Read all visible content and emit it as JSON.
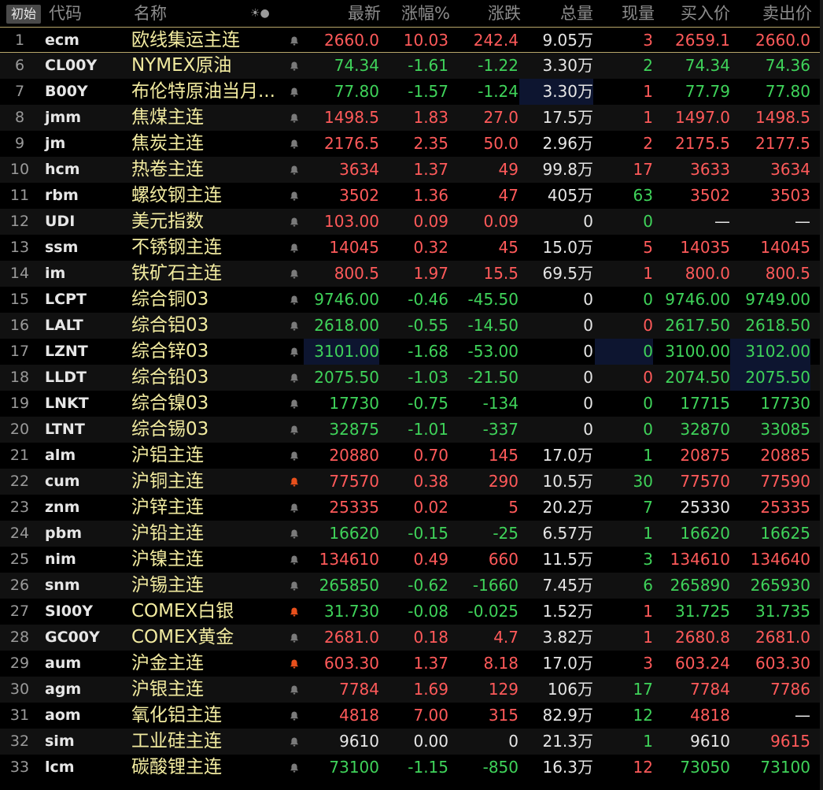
{
  "header": {
    "init_label": "初始",
    "columns": [
      "代码",
      "名称",
      "",
      "最新",
      "涨幅%",
      "涨跌",
      "总量",
      "现量",
      "买入价",
      "卖出价"
    ],
    "sort_icon": "☀●"
  },
  "rows": [
    {
      "idx": "1",
      "code": "ecm",
      "name": "欧线集运主连",
      "alert": false,
      "last": "2660.0",
      "pct": "10.03",
      "chg": "242.4",
      "vol": "9.05万",
      "cur": "3",
      "bid": "2659.1",
      "ask": "2660.0",
      "dir": "up",
      "bidDir": "up",
      "askDir": "up",
      "curDir": "up"
    },
    {
      "idx": "6",
      "code": "CL00Y",
      "name": "NYMEX原油",
      "alert": false,
      "last": "74.34",
      "pct": "-1.61",
      "chg": "-1.22",
      "vol": "3.30万",
      "cur": "2",
      "bid": "74.34",
      "ask": "74.36",
      "dir": "down",
      "bidDir": "down",
      "askDir": "down",
      "curDir": "down"
    },
    {
      "idx": "7",
      "code": "B00Y",
      "name": "布伦特原油当月...",
      "alert": false,
      "last": "77.80",
      "pct": "-1.57",
      "chg": "-1.24",
      "vol": "3.30万",
      "cur": "1",
      "bid": "77.79",
      "ask": "77.80",
      "dir": "down",
      "bidDir": "down",
      "askDir": "down",
      "curDir": "up",
      "volHl": true
    },
    {
      "idx": "8",
      "code": "jmm",
      "name": "焦煤主连",
      "alert": false,
      "last": "1498.5",
      "pct": "1.83",
      "chg": "27.0",
      "vol": "17.5万",
      "cur": "1",
      "bid": "1497.0",
      "ask": "1498.5",
      "dir": "up",
      "bidDir": "up",
      "askDir": "up",
      "curDir": "up"
    },
    {
      "idx": "9",
      "code": "jm",
      "name": "焦炭主连",
      "alert": false,
      "last": "2176.5",
      "pct": "2.35",
      "chg": "50.0",
      "vol": "2.96万",
      "cur": "2",
      "bid": "2175.5",
      "ask": "2177.5",
      "dir": "up",
      "bidDir": "up",
      "askDir": "up",
      "curDir": "up"
    },
    {
      "idx": "10",
      "code": "hcm",
      "name": "热卷主连",
      "alert": false,
      "last": "3634",
      "pct": "1.37",
      "chg": "49",
      "vol": "99.8万",
      "cur": "17",
      "bid": "3633",
      "ask": "3634",
      "dir": "up",
      "bidDir": "up",
      "askDir": "up",
      "curDir": "up"
    },
    {
      "idx": "11",
      "code": "rbm",
      "name": "螺纹钢主连",
      "alert": false,
      "last": "3502",
      "pct": "1.36",
      "chg": "47",
      "vol": "405万",
      "cur": "63",
      "bid": "3502",
      "ask": "3503",
      "dir": "up",
      "bidDir": "up",
      "askDir": "up",
      "curDir": "down"
    },
    {
      "idx": "12",
      "code": "UDI",
      "name": "美元指数",
      "alert": false,
      "last": "103.00",
      "pct": "0.09",
      "chg": "0.09",
      "vol": "0",
      "cur": "0",
      "bid": "—",
      "ask": "—",
      "dir": "up",
      "bidDir": "flat",
      "askDir": "flat",
      "curDir": "down"
    },
    {
      "idx": "13",
      "code": "ssm",
      "name": "不锈钢主连",
      "alert": false,
      "last": "14045",
      "pct": "0.32",
      "chg": "45",
      "vol": "15.0万",
      "cur": "5",
      "bid": "14035",
      "ask": "14045",
      "dir": "up",
      "bidDir": "up",
      "askDir": "up",
      "curDir": "up"
    },
    {
      "idx": "14",
      "code": "im",
      "name": "铁矿石主连",
      "alert": false,
      "last": "800.5",
      "pct": "1.97",
      "chg": "15.5",
      "vol": "69.5万",
      "cur": "1",
      "bid": "800.0",
      "ask": "800.5",
      "dir": "up",
      "bidDir": "up",
      "askDir": "up",
      "curDir": "up"
    },
    {
      "idx": "15",
      "code": "LCPT",
      "name": "综合铜03",
      "alert": false,
      "last": "9746.00",
      "pct": "-0.46",
      "chg": "-45.50",
      "vol": "0",
      "cur": "0",
      "bid": "9746.00",
      "ask": "9749.00",
      "dir": "down",
      "bidDir": "down",
      "askDir": "down",
      "curDir": "down"
    },
    {
      "idx": "16",
      "code": "LALT",
      "name": "综合铝03",
      "alert": false,
      "last": "2618.00",
      "pct": "-0.55",
      "chg": "-14.50",
      "vol": "0",
      "cur": "0",
      "bid": "2617.50",
      "ask": "2618.50",
      "dir": "down",
      "bidDir": "down",
      "askDir": "down",
      "curDir": "up"
    },
    {
      "idx": "17",
      "code": "LZNT",
      "name": "综合锌03",
      "alert": false,
      "last": "3101.00",
      "pct": "-1.68",
      "chg": "-53.00",
      "vol": "0",
      "cur": "0",
      "bid": "3100.00",
      "ask": "3102.00",
      "dir": "down",
      "bidDir": "down",
      "askDir": "down",
      "curDir": "down",
      "lastHl": true,
      "curHl": true,
      "askHl": true
    },
    {
      "idx": "18",
      "code": "LLDT",
      "name": "综合铅03",
      "alert": false,
      "last": "2075.50",
      "pct": "-1.03",
      "chg": "-21.50",
      "vol": "0",
      "cur": "0",
      "bid": "2074.50",
      "ask": "2075.50",
      "dir": "down",
      "bidDir": "down",
      "askDir": "down",
      "curDir": "up",
      "askHl": true
    },
    {
      "idx": "19",
      "code": "LNKT",
      "name": "综合镍03",
      "alert": false,
      "last": "17730",
      "pct": "-0.75",
      "chg": "-134",
      "vol": "0",
      "cur": "0",
      "bid": "17715",
      "ask": "17730",
      "dir": "down",
      "bidDir": "down",
      "askDir": "down",
      "curDir": "down"
    },
    {
      "idx": "20",
      "code": "LTNT",
      "name": "综合锡03",
      "alert": false,
      "last": "32875",
      "pct": "-1.01",
      "chg": "-337",
      "vol": "0",
      "cur": "0",
      "bid": "32870",
      "ask": "33085",
      "dir": "down",
      "bidDir": "down",
      "askDir": "down",
      "curDir": "down"
    },
    {
      "idx": "21",
      "code": "alm",
      "name": "沪铝主连",
      "alert": false,
      "last": "20880",
      "pct": "0.70",
      "chg": "145",
      "vol": "17.0万",
      "cur": "1",
      "bid": "20875",
      "ask": "20885",
      "dir": "up",
      "bidDir": "up",
      "askDir": "up",
      "curDir": "down"
    },
    {
      "idx": "22",
      "code": "cum",
      "name": "沪铜主连",
      "alert": true,
      "last": "77570",
      "pct": "0.38",
      "chg": "290",
      "vol": "10.5万",
      "cur": "30",
      "bid": "77570",
      "ask": "77590",
      "dir": "up",
      "bidDir": "up",
      "askDir": "up",
      "curDir": "down"
    },
    {
      "idx": "23",
      "code": "znm",
      "name": "沪锌主连",
      "alert": false,
      "last": "25335",
      "pct": "0.02",
      "chg": "5",
      "vol": "20.2万",
      "cur": "7",
      "bid": "25330",
      "ask": "25335",
      "dir": "up",
      "bidDir": "flat",
      "askDir": "up",
      "curDir": "down"
    },
    {
      "idx": "24",
      "code": "pbm",
      "name": "沪铅主连",
      "alert": false,
      "last": "16620",
      "pct": "-0.15",
      "chg": "-25",
      "vol": "6.57万",
      "cur": "1",
      "bid": "16620",
      "ask": "16625",
      "dir": "down",
      "bidDir": "down",
      "askDir": "down",
      "curDir": "down"
    },
    {
      "idx": "25",
      "code": "nim",
      "name": "沪镍主连",
      "alert": false,
      "last": "134610",
      "pct": "0.49",
      "chg": "660",
      "vol": "11.5万",
      "cur": "3",
      "bid": "134610",
      "ask": "134640",
      "dir": "up",
      "bidDir": "up",
      "askDir": "up",
      "curDir": "down"
    },
    {
      "idx": "26",
      "code": "snm",
      "name": "沪锡主连",
      "alert": false,
      "last": "265850",
      "pct": "-0.62",
      "chg": "-1660",
      "vol": "7.45万",
      "cur": "6",
      "bid": "265890",
      "ask": "265930",
      "dir": "down",
      "bidDir": "down",
      "askDir": "down",
      "curDir": "down"
    },
    {
      "idx": "27",
      "code": "SI00Y",
      "name": "COMEX白银",
      "alert": true,
      "last": "31.730",
      "pct": "-0.08",
      "chg": "-0.025",
      "vol": "1.52万",
      "cur": "1",
      "bid": "31.725",
      "ask": "31.735",
      "dir": "down",
      "bidDir": "down",
      "askDir": "down",
      "curDir": "up"
    },
    {
      "idx": "28",
      "code": "GC00Y",
      "name": "COMEX黄金",
      "alert": false,
      "last": "2681.0",
      "pct": "0.18",
      "chg": "4.7",
      "vol": "3.82万",
      "cur": "1",
      "bid": "2680.8",
      "ask": "2681.0",
      "dir": "up",
      "bidDir": "up",
      "askDir": "up",
      "curDir": "up"
    },
    {
      "idx": "29",
      "code": "aum",
      "name": "沪金主连",
      "alert": true,
      "last": "603.30",
      "pct": "1.37",
      "chg": "8.18",
      "vol": "17.0万",
      "cur": "3",
      "bid": "603.24",
      "ask": "603.30",
      "dir": "up",
      "bidDir": "up",
      "askDir": "up",
      "curDir": "up"
    },
    {
      "idx": "30",
      "code": "agm",
      "name": "沪银主连",
      "alert": false,
      "last": "7784",
      "pct": "1.69",
      "chg": "129",
      "vol": "106万",
      "cur": "17",
      "bid": "7784",
      "ask": "7786",
      "dir": "up",
      "bidDir": "up",
      "askDir": "up",
      "curDir": "down"
    },
    {
      "idx": "31",
      "code": "aom",
      "name": "氧化铝主连",
      "alert": false,
      "last": "4818",
      "pct": "7.00",
      "chg": "315",
      "vol": "82.9万",
      "cur": "12",
      "bid": "4818",
      "ask": "—",
      "dir": "up",
      "bidDir": "up",
      "askDir": "flat",
      "curDir": "down"
    },
    {
      "idx": "32",
      "code": "sim",
      "name": "工业硅主连",
      "alert": false,
      "last": "9610",
      "pct": "0.00",
      "chg": "0",
      "vol": "21.3万",
      "cur": "1",
      "bid": "9610",
      "ask": "9615",
      "dir": "flat",
      "bidDir": "flat",
      "askDir": "up",
      "curDir": "down"
    },
    {
      "idx": "33",
      "code": "lcm",
      "name": "碳酸锂主连",
      "alert": false,
      "last": "73100",
      "pct": "-1.15",
      "chg": "-850",
      "vol": "16.3万",
      "cur": "12",
      "bid": "73050",
      "ask": "73100",
      "dir": "down",
      "bidDir": "down",
      "askDir": "down",
      "curDir": "up"
    }
  ],
  "colors": {
    "up": "#ff5a5a",
    "down": "#3fd35a",
    "name": "#f2eba0",
    "alert_bell": "#e8501c"
  },
  "icons": {
    "bell": "bell-icon",
    "sort": "sort-icon"
  }
}
